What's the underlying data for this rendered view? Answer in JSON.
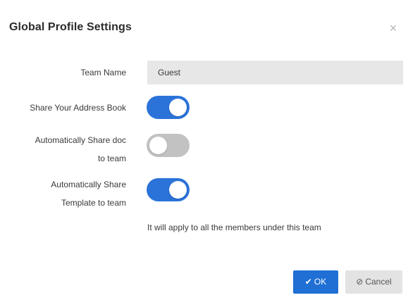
{
  "dialog": {
    "title": "Global Profile Settings",
    "close_icon": "close-icon"
  },
  "form": {
    "team_name": {
      "label": "Team Name",
      "value": "Guest"
    },
    "share_address_book": {
      "label": "Share Your Address Book",
      "enabled": true
    },
    "share_doc": {
      "label_line1": "Automatically Share doc",
      "label_line2": "to team",
      "enabled": false
    },
    "share_template": {
      "label_line1": "Automatically Share",
      "label_line2": "Template to team",
      "enabled": true
    },
    "note": "It will apply to all the members under this team"
  },
  "buttons": {
    "ok_label": "OK",
    "ok_icon": "check-icon",
    "cancel_label": "Cancel",
    "cancel_icon": "ban-icon"
  },
  "colors": {
    "toggle_on": "#2b73d9",
    "toggle_off": "#c2c2c2",
    "ok_button": "#1f6fd4",
    "cancel_button": "#e3e3e3"
  }
}
